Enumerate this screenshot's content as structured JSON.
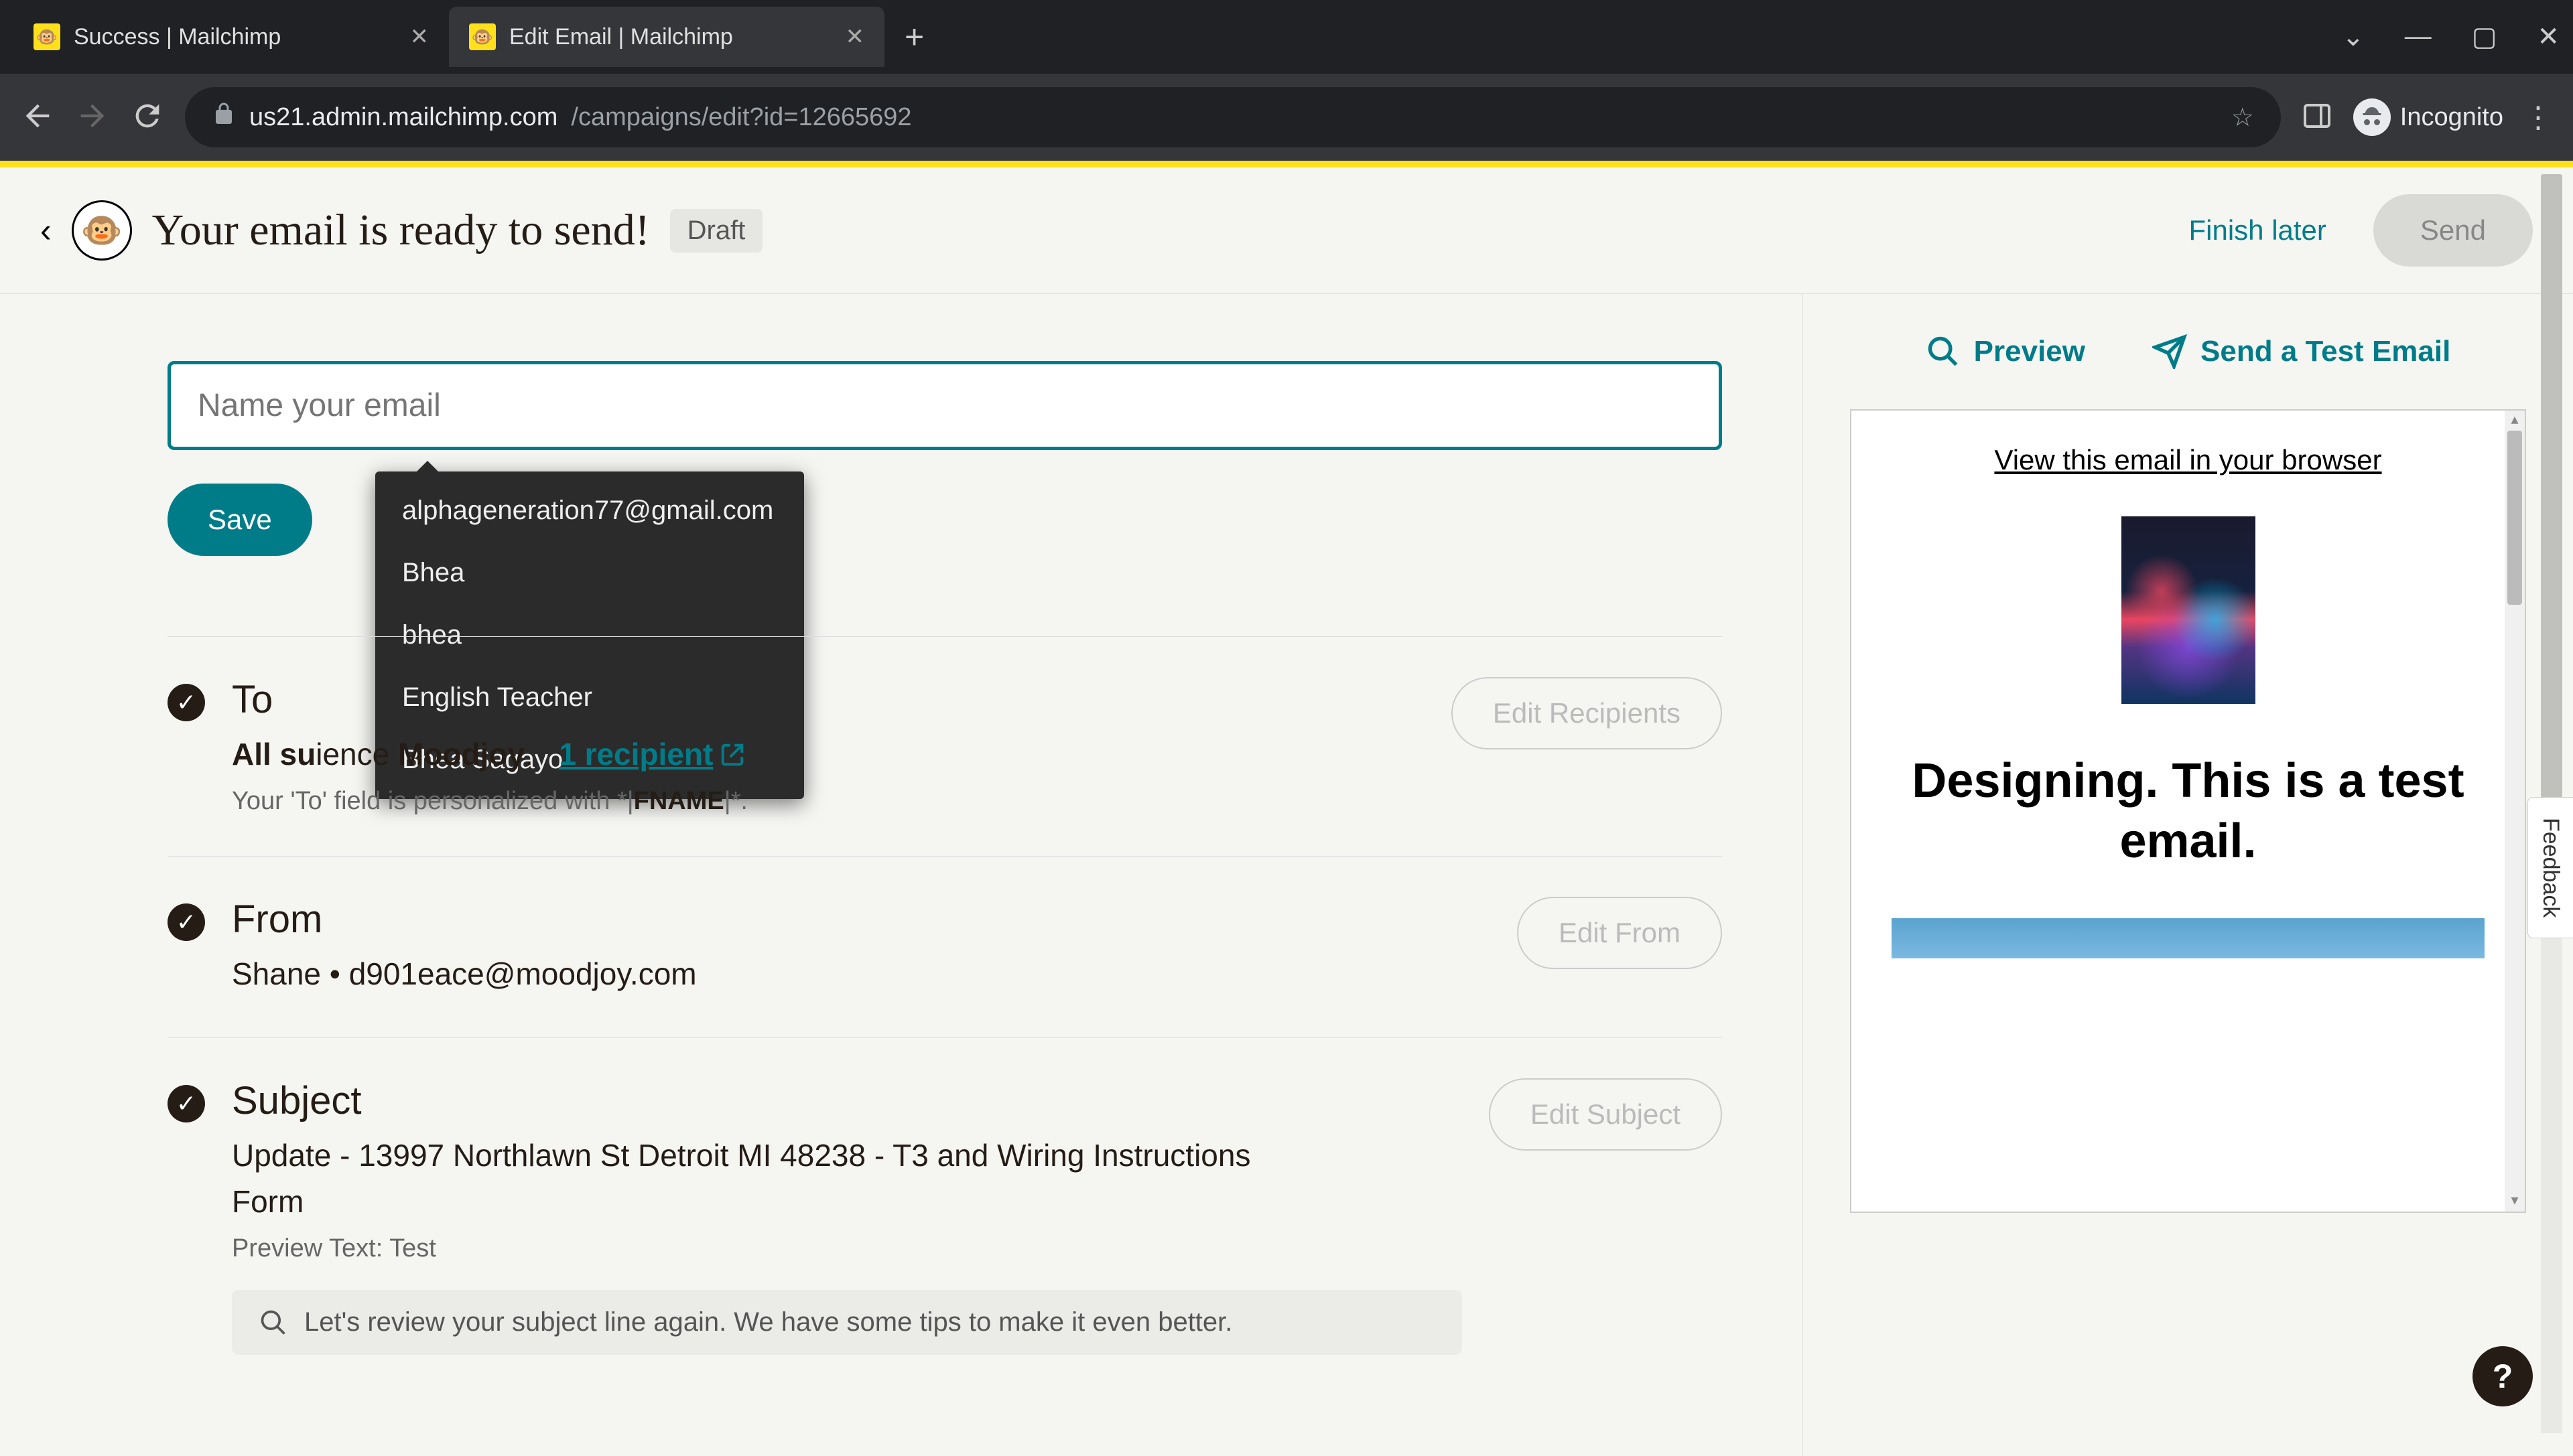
{
  "browser": {
    "tabs": [
      {
        "title": "Success | Mailchimp",
        "active": false
      },
      {
        "title": "Edit Email | Mailchimp",
        "active": true
      }
    ],
    "url_host": "us21.admin.mailchimp.com",
    "url_path": "/campaigns/edit?id=12665692",
    "incognito_label": "Incognito"
  },
  "header": {
    "title": "Your email is ready to send!",
    "status": "Draft",
    "finish_later": "Finish later",
    "send": "Send"
  },
  "name_input": {
    "placeholder": "Name your email",
    "value": ""
  },
  "autocomplete": [
    "alphageneration77@gmail.com",
    "Bhea",
    "bhea",
    "English Teacher",
    "Bhea Sagayo"
  ],
  "actions": {
    "save": "Save"
  },
  "sections": {
    "to": {
      "title": "To",
      "line_prefix": "All su",
      "line_mid": "ience ",
      "audience": "Moodjoy",
      "line_suffix": ".",
      "recipients_label": "1 recipient",
      "sub_prefix": "Your 'To' field is personalized with *|",
      "sub_token": "FNAME",
      "sub_suffix": "|*.",
      "edit": "Edit Recipients"
    },
    "from": {
      "title": "From",
      "name": "Shane",
      "sep": "  •  ",
      "email": "d901eace@moodjoy.com",
      "edit": "Edit From"
    },
    "subject": {
      "title": "Subject",
      "text": "Update - 13997 Northlawn St Detroit MI 48238 - T3 and Wiring Instructions Form",
      "preview_label": "Preview Text: ",
      "preview_value": "Test",
      "edit": "Edit Subject",
      "tip": "Let's review your subject line again. We have some tips to make it even better."
    }
  },
  "right": {
    "preview": "Preview",
    "send_test": "Send a Test Email",
    "view_in_browser": "View this email in your browser",
    "heading": "Designing. This is a test email."
  },
  "misc": {
    "feedback": "Feedback",
    "help": "?"
  }
}
